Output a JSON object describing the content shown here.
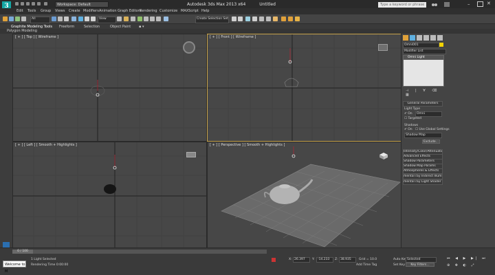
{
  "title_bar": {
    "workspace": "Workspace: Default",
    "app_title": "Autodesk 3ds Max  2013 x64",
    "file_name": "Untitled",
    "search_placeholder": "Type a keyword or phrase"
  },
  "menu": [
    "Edit",
    "Tools",
    "Group",
    "Views",
    "Create",
    "Modifiers",
    "Animation",
    "Graph Editors",
    "Rendering",
    "Customize",
    "MAXScript",
    "Help"
  ],
  "toolbar": {
    "selection_filter": "All",
    "ref_coord": "View",
    "named_sel": "Create Selection Set"
  },
  "ribbon": {
    "tabs": [
      "Graphite Modeling Tools",
      "Freeform",
      "Selection",
      "Object Paint"
    ],
    "panel": "Polygon Modeling"
  },
  "viewports": {
    "top": "[ + ] [ Top ] [ Wireframe ]",
    "front": "[ + ] [ Front ] [ Wireframe ]",
    "left": "[ + ] [ Left ] [ Smooth + Highlights ]",
    "perspective": "[ + ] [ Perspective ] [ Smooth + Highlights ]"
  },
  "command_panel": {
    "object_name": "Omni001",
    "modifier_list": "Modifier List",
    "stack_item": "Omni Light",
    "general_parameters": "General Parameters",
    "light_type": "Light Type",
    "on_label": "On",
    "type_value": "Omni",
    "targeted": "Targeted",
    "shadows": "Shadows",
    "use_global": "Use Global Settings",
    "shadow_type": "Shadow Map",
    "exclude": "Exclude...",
    "rollouts": [
      "Intensity/Color/Attenuation",
      "Advanced Effects",
      "Shadow Parameters",
      "Shadow Map Params",
      "Atmospheres & Effects",
      "mental ray Indirect Illumination",
      "mental ray Light Shader"
    ]
  },
  "status": {
    "timeline": "0 / 100",
    "maxscript": "Welcome to M",
    "selected": "1 Light Selected",
    "render_time": "Rendering Time  0:00:00",
    "x_label": "X:",
    "x": "26.397",
    "y_label": "Y:",
    "y": "-14.233",
    "z_label": "Z:",
    "z": "38.935",
    "grid": "Grid = 10.0",
    "add_time_tag": "Add Time Tag",
    "auto_key": "Auto Key",
    "set_key": "Set Key",
    "key_mode": "Selected",
    "key_filters": "Key Filters..."
  },
  "colors": {
    "active_border": "#c7a34a",
    "accent": "#14a7a5",
    "toolbar_blue": "#3f8fd8"
  }
}
